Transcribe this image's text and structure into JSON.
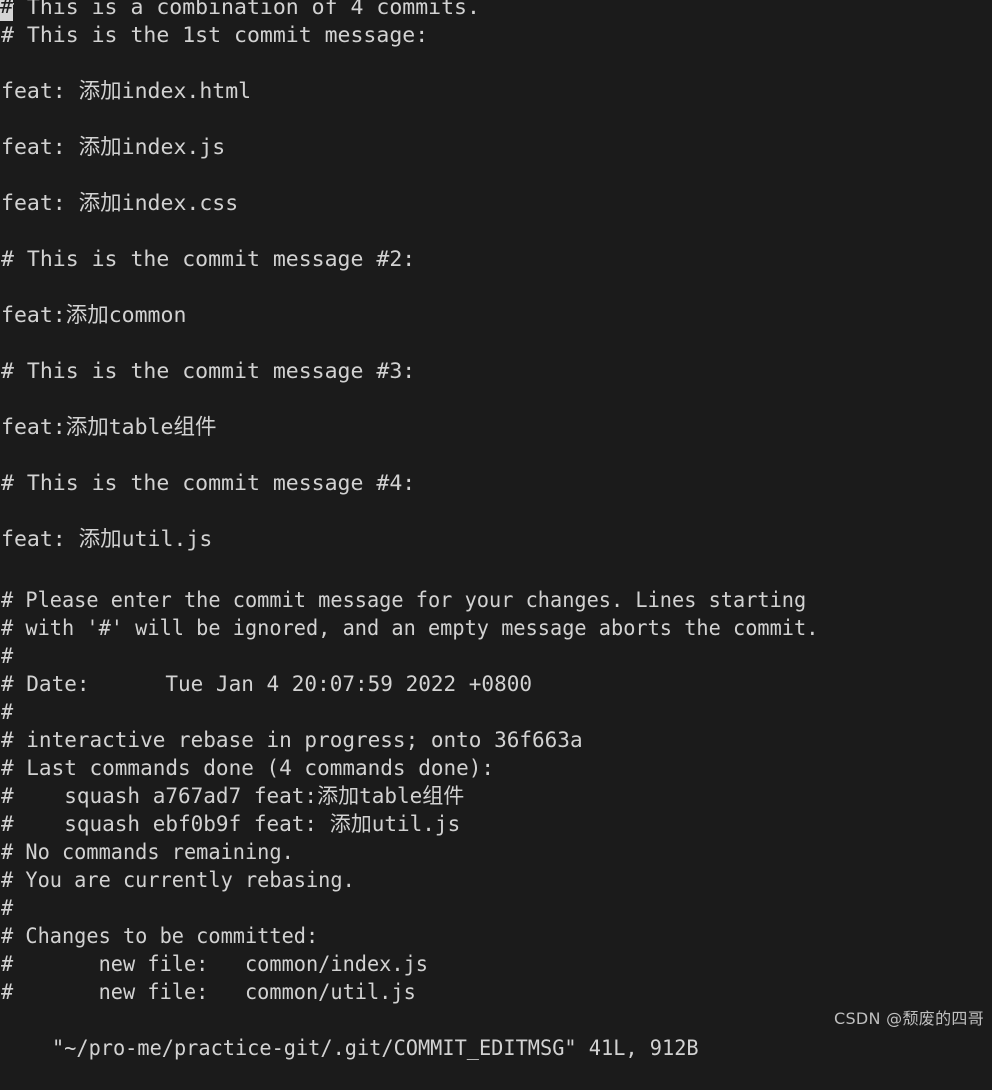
{
  "editor": {
    "name": "vim",
    "background_color": "#1b1b1b",
    "foreground_color": "#d2d2d2",
    "cursor_color": "#d5d5d5",
    "cursor_char": "#"
  },
  "message_lines": [
    "# This is a combination of 4 commits.",
    "# This is the 1st commit message:",
    "",
    "feat: 添加index.html",
    "",
    "feat: 添加index.js",
    "",
    "feat: 添加index.css",
    "",
    "# This is the commit message #2:",
    "",
    "feat:添加common",
    "",
    "# This is the commit message #3:",
    "",
    "feat:添加table组件",
    "",
    "# This is the commit message #4:",
    "",
    "feat: 添加util.js",
    ""
  ],
  "comment_lines": [
    {
      "text": "# Please enter the commit message for your changes. Lines starting",
      "wide": false
    },
    {
      "text": "# with '#' will be ignored, and an empty message aborts the commit.",
      "wide": false
    },
    {
      "text": "#",
      "wide": false
    },
    {
      "text": "# Date:      Tue Jan 4 20:07:59 2022 +0800",
      "wide": true
    },
    {
      "text": "#",
      "wide": false
    },
    {
      "text": "# interactive rebase in progress; onto 36f663a",
      "wide": true
    },
    {
      "text": "# Last commands done (4 commands done):",
      "wide": true
    },
    {
      "text": "#    squash a767ad7 feat:添加table组件",
      "wide": true
    },
    {
      "text": "#    squash ebf0b9f feat: 添加util.js",
      "wide": true
    },
    {
      "text": "# No commands remaining.",
      "wide": false
    },
    {
      "text": "# You are currently rebasing.",
      "wide": false
    },
    {
      "text": "#",
      "wide": false
    },
    {
      "text": "# Changes to be committed:",
      "wide": false
    },
    {
      "text": "#       new file:   common/index.js",
      "wide": false
    },
    {
      "text": "#       new file:   common/util.js",
      "wide": false
    }
  ],
  "status": {
    "file_path": "~/pro-me/practice-git/.git/COMMIT_EDITMSG",
    "line_count": "41L",
    "byte_count": "912B",
    "text": "\"~/pro-me/practice-git/.git/COMMIT_EDITMSG\" 41L, 912B"
  },
  "watermark": {
    "text": "CSDN @颓废的四哥"
  }
}
